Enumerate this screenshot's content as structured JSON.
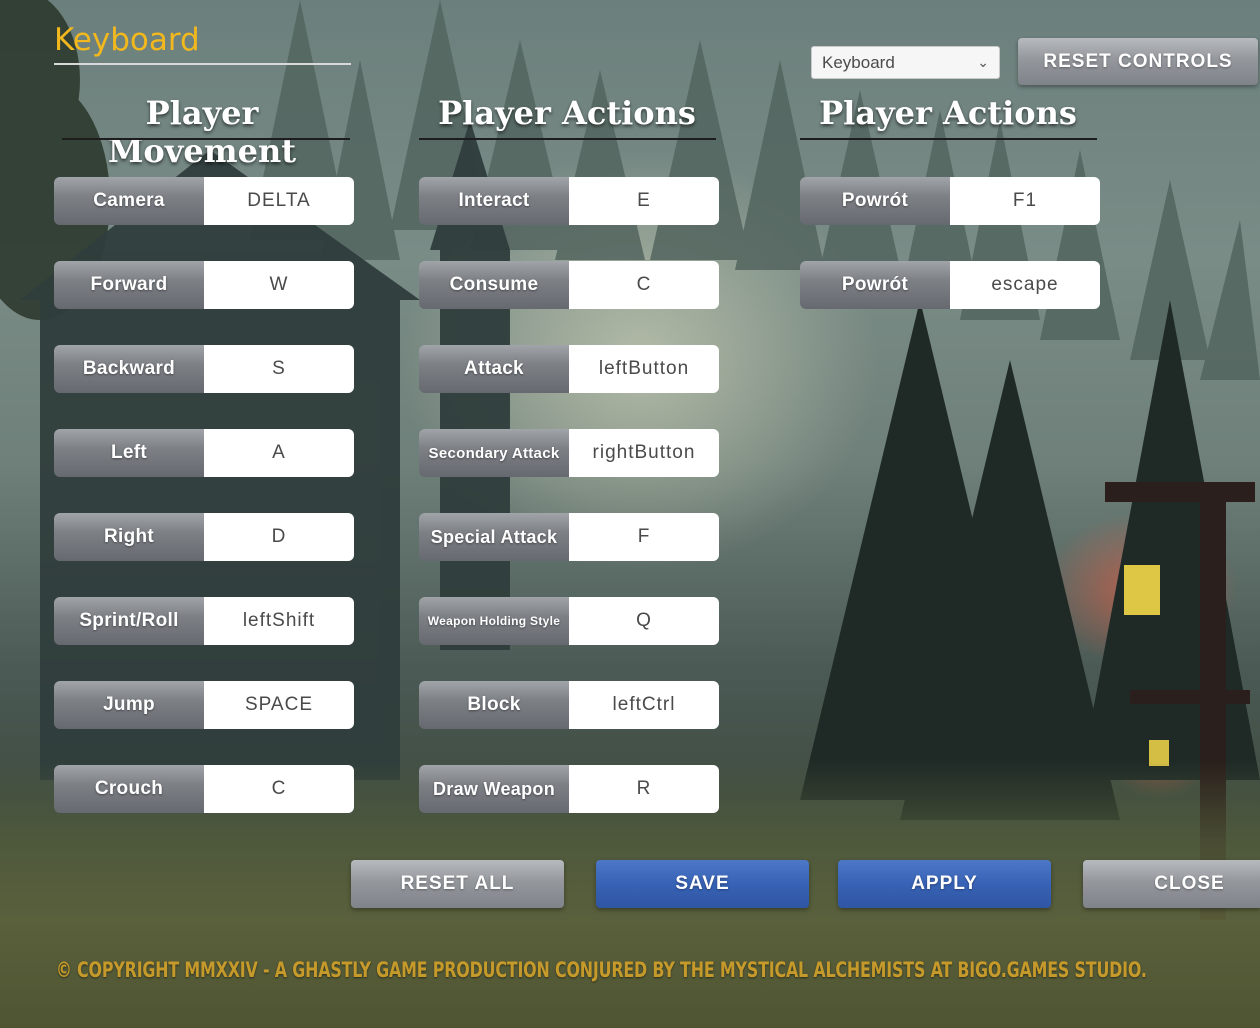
{
  "tab": {
    "title": "Keyboard"
  },
  "device_select": {
    "value": "Keyboard"
  },
  "buttons": {
    "reset_controls": "RESET CONTROLS",
    "reset_all": "RESET ALL",
    "save": "SAVE",
    "apply": "APPLY",
    "close": "CLOSE"
  },
  "columns": [
    {
      "title": "Player Movement",
      "bindings": [
        {
          "action": "Camera",
          "key": "DELTA"
        },
        {
          "action": "Forward",
          "key": "W"
        },
        {
          "action": "Backward",
          "key": "S"
        },
        {
          "action": "Left",
          "key": "A"
        },
        {
          "action": "Right",
          "key": "D"
        },
        {
          "action": "Sprint/Roll",
          "key": "leftShift"
        },
        {
          "action": "Jump",
          "key": "SPACE"
        },
        {
          "action": "Crouch",
          "key": "C"
        }
      ]
    },
    {
      "title": "Player Actions",
      "bindings": [
        {
          "action": "Interact",
          "key": "E"
        },
        {
          "action": "Consume",
          "key": "C"
        },
        {
          "action": "Attack",
          "key": "leftButton"
        },
        {
          "action": "Secondary Attack",
          "key": "rightButton"
        },
        {
          "action": "Special Attack",
          "key": "F"
        },
        {
          "action": "Weapon Holding Style",
          "key": "Q"
        },
        {
          "action": "Block",
          "key": "leftCtrl"
        },
        {
          "action": "Draw Weapon",
          "key": "R"
        }
      ]
    },
    {
      "title": "Player Actions",
      "bindings": [
        {
          "action": "Powrót",
          "key": "F1"
        },
        {
          "action": "Powrót",
          "key": "escape"
        }
      ]
    }
  ],
  "footer": {
    "copyright": "© COPYRIGHT MMXXIV - A GHASTLY GAME PRODUCTION CONJURED BY THE MYSTICAL ALCHEMISTS AT BIGO.GAMES STUDIO."
  },
  "colors": {
    "tab_title": "#f2b81e",
    "primary_button": "#3862b5",
    "secondary_button": "#94989d",
    "copyright": "#c69a2a"
  }
}
